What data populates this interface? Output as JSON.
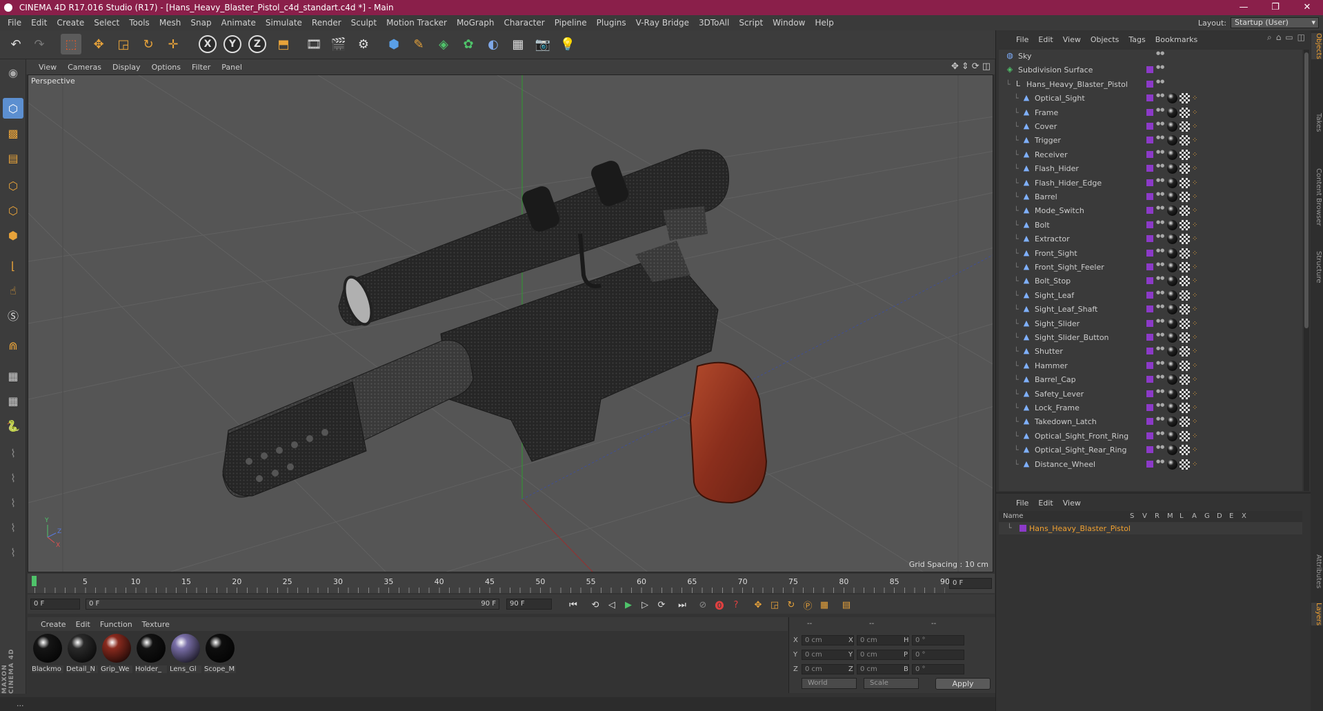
{
  "window": {
    "title": "CINEMA 4D R17.016 Studio (R17) - [Hans_Heavy_Blaster_Pistol_c4d_standart.c4d *] - Main",
    "controls": [
      "—",
      "❐",
      "✕"
    ]
  },
  "menubar": {
    "items": [
      "File",
      "Edit",
      "Create",
      "Select",
      "Tools",
      "Mesh",
      "Snap",
      "Animate",
      "Simulate",
      "Render",
      "Sculpt",
      "Motion Tracker",
      "MoGraph",
      "Character",
      "Pipeline",
      "Plugins",
      "V-Ray Bridge",
      "3DToAll",
      "Script",
      "Window",
      "Help"
    ],
    "layout_label": "Layout:",
    "layout_value": "Startup (User)"
  },
  "toolbar": {
    "axes": [
      "X",
      "Y",
      "Z"
    ]
  },
  "viewport": {
    "menu": [
      "View",
      "Cameras",
      "Display",
      "Options",
      "Filter",
      "Panel"
    ],
    "label": "Perspective",
    "grid_spacing": "Grid Spacing : 10 cm",
    "colors": {
      "background": "#555555",
      "grid": "#606060",
      "model": "#2a2a2a",
      "grip": "#9c3b22"
    }
  },
  "timeline": {
    "ticks": [
      "0",
      "5",
      "10",
      "15",
      "20",
      "25",
      "30",
      "35",
      "40",
      "45",
      "50",
      "55",
      "60",
      "65",
      "70",
      "75",
      "80",
      "85",
      "90"
    ],
    "end_field": "0 F",
    "start_field": "0 F",
    "range_start": "0 F",
    "range_end": "90 F",
    "max_field": "90 F"
  },
  "materials": {
    "menu": [
      "Create",
      "Edit",
      "Function",
      "Texture"
    ],
    "items": [
      {
        "name": "Blackmo",
        "color": "#151515"
      },
      {
        "name": "Detail_N",
        "color": "#2a2a2a"
      },
      {
        "name": "Grip_We",
        "color": "#8a2a1e"
      },
      {
        "name": "Holder_",
        "color": "#111111"
      },
      {
        "name": "Lens_Gl",
        "color": "#7a6fa8"
      },
      {
        "name": "Scope_M",
        "color": "#0e0e0e"
      }
    ]
  },
  "coordinates": {
    "header_left": "--",
    "header_mid": "--",
    "header_right": "--",
    "rows": [
      {
        "a": "X",
        "av": "0 cm",
        "b": "X",
        "bv": "0 cm",
        "c": "H",
        "cv": "0 °"
      },
      {
        "a": "Y",
        "av": "0 cm",
        "b": "Y",
        "bv": "0 cm",
        "c": "P",
        "cv": "0 °"
      },
      {
        "a": "Z",
        "av": "0 cm",
        "b": "Z",
        "bv": "0 cm",
        "c": "B",
        "cv": "0 °"
      }
    ],
    "space": "World",
    "mode": "Scale",
    "apply": "Apply"
  },
  "status": {
    "text": "..."
  },
  "maxon": "MAXON CINEMA 4D",
  "object_manager": {
    "menu": [
      "File",
      "Edit",
      "View",
      "Objects",
      "Tags",
      "Bookmarks"
    ],
    "objects": [
      {
        "name": "Sky",
        "indent": 0
      },
      {
        "name": "Subdivision Surface",
        "indent": 0
      },
      {
        "name": "Hans_Heavy_Blaster_Pistol",
        "indent": 1
      },
      {
        "name": "Optical_Sight",
        "indent": 2
      },
      {
        "name": "Frame",
        "indent": 2
      },
      {
        "name": "Cover",
        "indent": 2
      },
      {
        "name": "Trigger",
        "indent": 2
      },
      {
        "name": "Receiver",
        "indent": 2
      },
      {
        "name": "Flash_Hider",
        "indent": 2
      },
      {
        "name": "Flash_Hider_Edge",
        "indent": 2
      },
      {
        "name": "Barrel",
        "indent": 2
      },
      {
        "name": "Mode_Switch",
        "indent": 2
      },
      {
        "name": "Bolt",
        "indent": 2
      },
      {
        "name": "Extractor",
        "indent": 2
      },
      {
        "name": "Front_Sight",
        "indent": 2
      },
      {
        "name": "Front_Sight_Feeler",
        "indent": 2
      },
      {
        "name": "Bolt_Stop",
        "indent": 2
      },
      {
        "name": "Sight_Leaf",
        "indent": 2
      },
      {
        "name": "Sight_Leaf_Shaft",
        "indent": 2
      },
      {
        "name": "Sight_Slider",
        "indent": 2
      },
      {
        "name": "Sight_Slider_Button",
        "indent": 2
      },
      {
        "name": "Shutter",
        "indent": 2
      },
      {
        "name": "Hammer",
        "indent": 2
      },
      {
        "name": "Barrel_Cap",
        "indent": 2
      },
      {
        "name": "Safety_Lever",
        "indent": 2
      },
      {
        "name": "Lock_Frame",
        "indent": 2
      },
      {
        "name": "Takedown_Latch",
        "indent": 2
      },
      {
        "name": "Optical_Sight_Front_Ring",
        "indent": 2
      },
      {
        "name": "Optical_Sight_Rear_Ring",
        "indent": 2
      },
      {
        "name": "Distance_Wheel",
        "indent": 2
      }
    ]
  },
  "layer_manager": {
    "menu": [
      "File",
      "Edit",
      "View"
    ],
    "columns": [
      "Name",
      "S",
      "V",
      "R",
      "M",
      "L",
      "A",
      "G",
      "D",
      "E",
      "X"
    ],
    "layer": "Hans_Heavy_Blaster_Pistol"
  },
  "side_tabs": [
    "Objects",
    "Takes",
    "Content Browser",
    "Structure",
    "Attributes",
    "Layers"
  ]
}
